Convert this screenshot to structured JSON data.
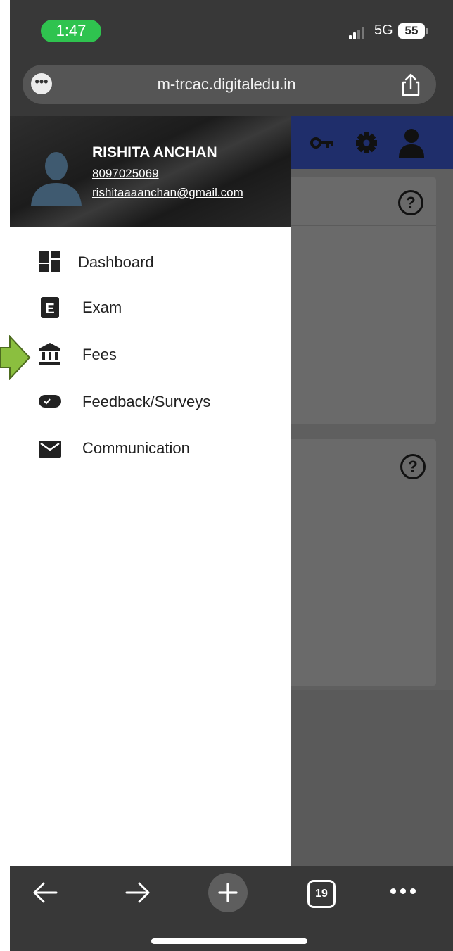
{
  "status_bar": {
    "time": "1:47",
    "network": "5G",
    "battery": "55"
  },
  "browser": {
    "url": "m-trcac.digitaledu.in",
    "tab_count": "19"
  },
  "profile": {
    "name": "RISHITA ANCHAN",
    "phone": "8097025069",
    "email": "rishitaaaanchan@gmail.com"
  },
  "menu": {
    "items": [
      {
        "label": "Dashboard",
        "icon": "dashboard-icon"
      },
      {
        "label": "Exam",
        "icon": "exam-icon"
      },
      {
        "label": "Fees",
        "icon": "bank-icon"
      },
      {
        "label": "Feedback/Surveys",
        "icon": "feedback-icon"
      },
      {
        "label": "Communication",
        "icon": "mail-icon"
      }
    ]
  },
  "help_glyph": "?",
  "colors": {
    "status_pill": "#2fc34f",
    "page_header": "#1f2e6b",
    "pointer_arrow": "#8bbf3f"
  }
}
